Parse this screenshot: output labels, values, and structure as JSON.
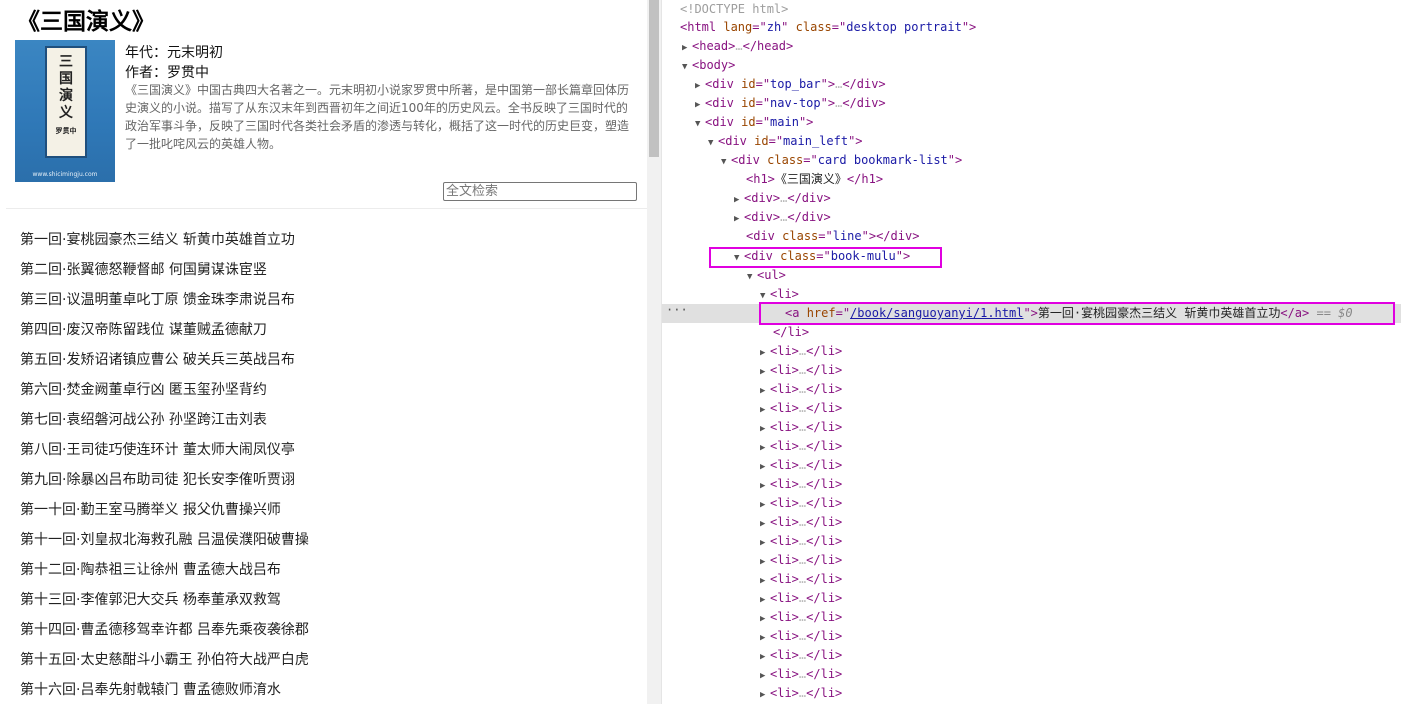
{
  "book": {
    "title": "《三国演义》",
    "era": "年代：元末明初",
    "author": "作者：罗贯中",
    "description": "《三国演义》中国古典四大名著之一。元末明初小说家罗贯中所著，是中国第一部长篇章回体历史演义的小说。描写了从东汉末年到西晋初年之间近100年的历史风云。全书反映了三国时代的政治军事斗争，反映了三国时代各类社会矛盾的渗透与转化，概括了这一时代的历史巨变，塑造了一批叱咤风云的英雄人物。",
    "cover": {
      "chars": [
        "三",
        "国",
        "演",
        "义"
      ],
      "author": "罗贯中",
      "site": "www.shicimingju.com"
    }
  },
  "search": {
    "placeholder": "全文检索"
  },
  "chapters": [
    "第一回·宴桃园豪杰三结义 斩黄巾英雄首立功",
    "第二回·张翼德怒鞭督邮 何国舅谋诛宦竖",
    "第三回·议温明董卓叱丁原 馈金珠李肃说吕布",
    "第四回·废汉帝陈留践位 谋董贼孟德献刀",
    "第五回·发矫诏诸镇应曹公 破关兵三英战吕布",
    "第六回·焚金阙董卓行凶 匿玉玺孙坚背约",
    "第七回·袁绍磐河战公孙 孙坚跨江击刘表",
    "第八回·王司徒巧使连环计 董太师大闹凤仪亭",
    "第九回·除暴凶吕布助司徒 犯长安李傕听贾诩",
    "第一十回·勤王室马腾举义 报父仇曹操兴师",
    "第十一回·刘皇叔北海救孔融 吕温侯濮阳破曹操",
    "第十二回·陶恭祖三让徐州 曹孟德大战吕布",
    "第十三回·李傕郭汜大交兵 杨奉董承双救驾",
    "第十四回·曹孟德移驾幸许都 吕奉先乘夜袭徐郡",
    "第十五回·太史慈酣斗小霸王 孙伯符大战严白虎",
    "第十六回·吕奉先射戟辕门 曹孟德败师淯水"
  ],
  "devtools": {
    "doctype": "<!DOCTYPE html>",
    "html_lang": "zh",
    "html_class": "desktop portrait",
    "top_bar_id": "top_bar",
    "nav_top_id": "nav-top",
    "main_id": "main",
    "main_left_id": "main_left",
    "card_class": "card bookmark-list",
    "h1_text": "《三国演义》",
    "line_class": "line",
    "mulu_class": "book-mulu",
    "a_href": "/book/sanguoyanyi/1.html",
    "a_text": "第一回·宴桃园豪杰三结义 斩黄巾英雄首立功",
    "selected_marker": "== $0",
    "ellipsis": "…",
    "collapsed_li_count": 19
  }
}
